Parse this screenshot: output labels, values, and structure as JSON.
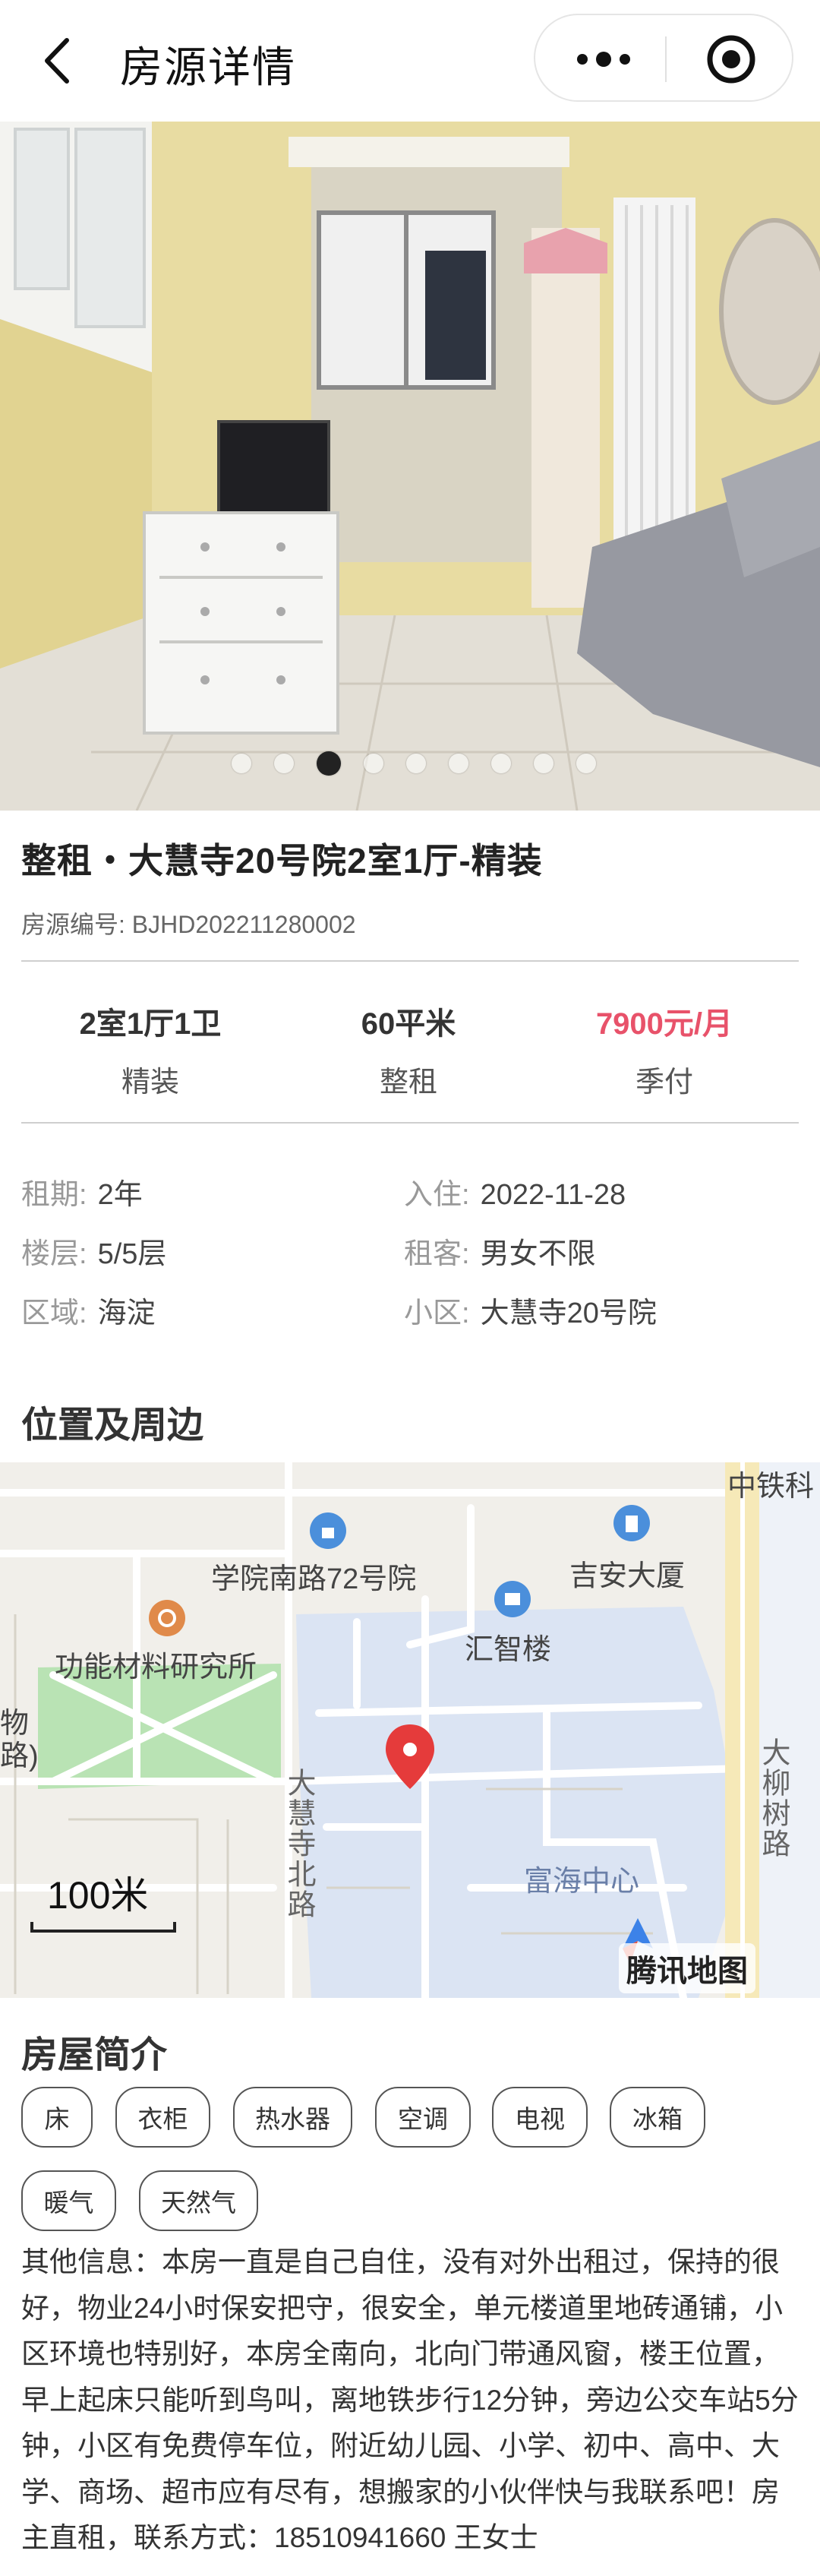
{
  "navbar": {
    "title": "房源详情",
    "back_icon": "back-arrow-icon",
    "more_icon": "more-icon",
    "close_icon": "target-close-icon"
  },
  "carousel": {
    "slide_count": 9,
    "active_index": 2
  },
  "house": {
    "title": "整租・大慧寺20号院2室1厅-精装",
    "code_label": "房源编号:",
    "code": "BJHD202211280002"
  },
  "stats": [
    {
      "value": "2室1厅1卫",
      "sub": "精装"
    },
    {
      "value": "60平米",
      "sub": "整租"
    },
    {
      "value": "7900元/月",
      "sub": "季付"
    }
  ],
  "info": {
    "lease_term": {
      "label": "租期:",
      "value": "2年"
    },
    "move_in": {
      "label": "入住:",
      "value": "2022-11-28"
    },
    "floor": {
      "label": "楼层:",
      "value": "5/5层"
    },
    "tenant": {
      "label": "租客:",
      "value": "男女不限"
    },
    "district": {
      "label": "区域:",
      "value": "海淀"
    },
    "community": {
      "label": "小区:",
      "value": "大慧寺20号院"
    }
  },
  "location": {
    "heading": "位置及周边",
    "labels": {
      "zhongtie": "中铁科",
      "xueyuan": "学院南路72号院",
      "jian": "吉安大厦",
      "gongneng": "功能材料研究所",
      "huizhi": "汇智楼",
      "wu": "物",
      "lu_paren": "路)",
      "dahuisi_road": "大慧寺北路",
      "daliushu_road": "大柳树路",
      "fuhai": "富海中心"
    },
    "scale": "100米",
    "brand": "腾讯地图"
  },
  "intro": {
    "heading": "房屋简介",
    "tags": [
      "床",
      "衣柜",
      "热水器",
      "空调",
      "电视",
      "冰箱",
      "暖气",
      "天然气"
    ],
    "description": "其他信息：本房一直是自己自住，没有对外出租过，保持的很好，物业24小时保安把守，很安全，单元楼道里地砖通铺，小区环境也特别好，本房全南向，北向门带通风窗，楼王位置，早上起床只能听到鸟叫，离地铁步行12分钟，旁边公交车站5分钟，小区有免费停车位，附近幼儿园、小学、初中、高中、大学、商场、超市应有尽有，想搬家的小伙伴快与我联系吧！房主直租，联系方式：18510941660 王女士"
  },
  "colors": {
    "price": "#e8526a",
    "map_block": "#dbe4f3",
    "map_green": "#b9e3b4",
    "wall": "#e9dfa8"
  }
}
